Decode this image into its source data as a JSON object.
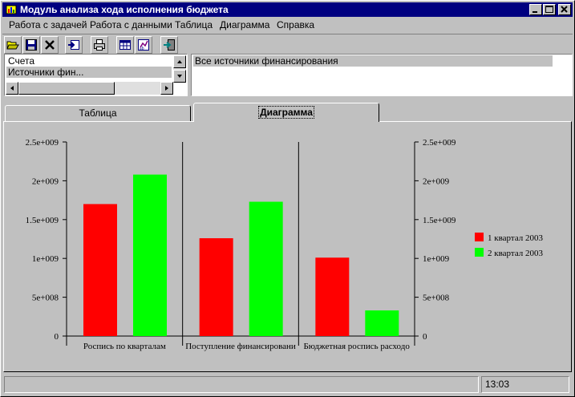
{
  "window": {
    "title": "Модуль анализа хода исполнения бюджета"
  },
  "menu": [
    {
      "label": "Работа с задачей"
    },
    {
      "label": "Работа с данными"
    },
    {
      "label": "Таблица"
    },
    {
      "label": "Диаграмма"
    },
    {
      "label": "Справка"
    }
  ],
  "toolbar": {
    "buttons": [
      {
        "icon": "open-folder-icon"
      },
      {
        "icon": "save-disk-icon"
      },
      {
        "icon": "delete-x-icon"
      },
      {
        "icon": "import-icon"
      },
      {
        "icon": "print-icon"
      },
      {
        "icon": "table-view-icon"
      },
      {
        "icon": "chart-switch-icon"
      },
      {
        "icon": "exit-icon"
      }
    ]
  },
  "left_list": {
    "items": [
      "Счета",
      "Источники фин..."
    ],
    "selected": "Источники фин..."
  },
  "right_list": {
    "items": [
      "Все источники финансирования"
    ]
  },
  "tabs": [
    {
      "label": "Таблица",
      "active": false
    },
    {
      "label": "Диаграмма",
      "active": true
    }
  ],
  "status": {
    "message": "",
    "time": "13:03"
  },
  "colors": {
    "series1": "#ff0000",
    "series2": "#00ff00",
    "titlebar": "#000080"
  },
  "chart_data": {
    "type": "bar",
    "categories": [
      "Роспись по кварталам",
      "Поступление финансировани",
      "Бюджетная роспись расходо"
    ],
    "series": [
      {
        "name": "1 квартал 2003",
        "values": [
          1700000000,
          1260000000,
          1010000000
        ]
      },
      {
        "name": "2 квартал 2003",
        "values": [
          2080000000,
          1730000000,
          330000000
        ]
      }
    ],
    "ylim": [
      0,
      2500000000
    ],
    "yticks": [
      "0",
      "5e+008",
      "1e+009",
      "1.5e+009",
      "2e+009",
      "2.5e+009"
    ],
    "right_axis": true,
    "grid": false,
    "legend": "right"
  }
}
